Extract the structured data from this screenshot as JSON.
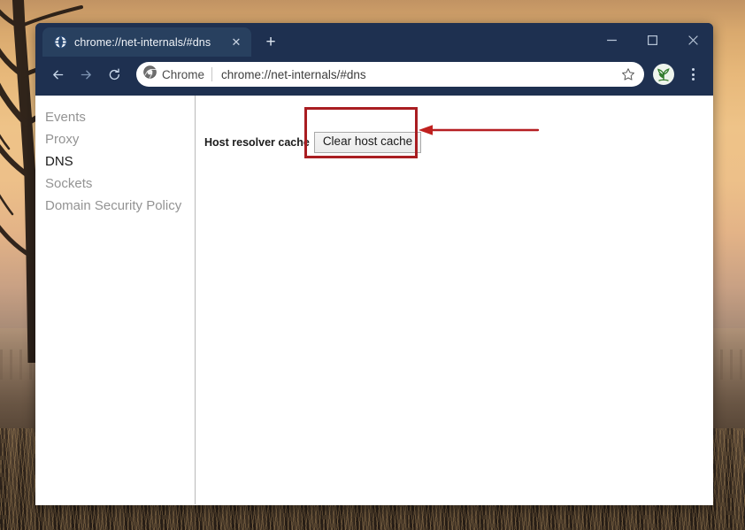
{
  "window": {
    "controls": {
      "minimize": "minimize-button",
      "maximize": "maximize-button",
      "close": "close-button"
    }
  },
  "tabstrip": {
    "tab": {
      "title": "chrome://net-internals/#dns",
      "favicon": "globe-icon",
      "close_label": "✕"
    },
    "new_tab_label": "+"
  },
  "toolbar": {
    "back_icon": "back-arrow-icon",
    "forward_icon": "forward-arrow-icon",
    "reload_icon": "reload-icon",
    "omnibox": {
      "chip_icon": "chrome-logo-icon",
      "chip_label": "Chrome",
      "url": "chrome://net-internals/#dns"
    },
    "star_icon": "bookmark-star-icon",
    "avatar_icon": "profile-avatar-icon",
    "menu_icon": "three-dot-menu-icon"
  },
  "sidebar": {
    "items": [
      {
        "label": "Events",
        "active": false
      },
      {
        "label": "Proxy",
        "active": false
      },
      {
        "label": "DNS",
        "active": true
      },
      {
        "label": "Sockets",
        "active": false
      },
      {
        "label": "Domain Security Policy",
        "active": false
      }
    ]
  },
  "content": {
    "cache_label": "Host resolver cache",
    "clear_button_label": "Clear host cache"
  },
  "annotation": {
    "box_color": "#a91d21",
    "arrow_color": "#b61f22",
    "arrow_direction": "left",
    "target": "Clear host cache"
  }
}
